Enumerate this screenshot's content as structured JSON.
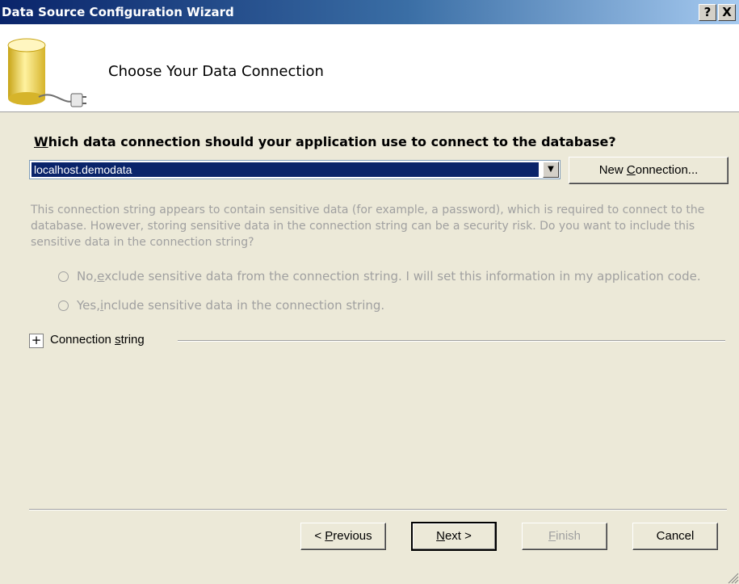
{
  "window": {
    "title": "Data Source Configuration Wizard",
    "help_label": "?",
    "close_label": "X"
  },
  "header": {
    "title": "Choose Your Data Connection",
    "icon": "database-icon"
  },
  "question": {
    "prefix": "W",
    "rest": "hich data connection should your application use to connect to the database?"
  },
  "connection": {
    "selected": "localhost.demodata",
    "new_connection_pre": "New ",
    "new_connection_accel": "C",
    "new_connection_post": "onnection..."
  },
  "description": "This connection string appears to contain sensitive data (for example, a password), which is required to connect to the database. However, storing sensitive data in the connection string can be a security risk. Do you want to include this sensitive data in the connection string?",
  "options": {
    "exclude_pre": "No, ",
    "exclude_accel": "e",
    "exclude_post": "xclude sensitive data from the connection string. I will set this information in my application code.",
    "include_pre": "Yes, ",
    "include_accel": "i",
    "include_post": "nclude sensitive data in the connection string."
  },
  "connection_string": {
    "expander": "+",
    "label_pre": "Connection ",
    "label_accel": "s",
    "label_post": "tring"
  },
  "buttons": {
    "previous_pre": "< ",
    "previous_accel": "P",
    "previous_post": "revious",
    "next_accel": "N",
    "next_post": "ext >",
    "finish_accel": "F",
    "finish_post": "inish",
    "cancel": "Cancel"
  },
  "colors": {
    "title_gradient_start": "#0a246a",
    "dialog_bg": "#ece9d8",
    "selection": "#0a246a",
    "disabled_text": "#a0a0a0"
  }
}
